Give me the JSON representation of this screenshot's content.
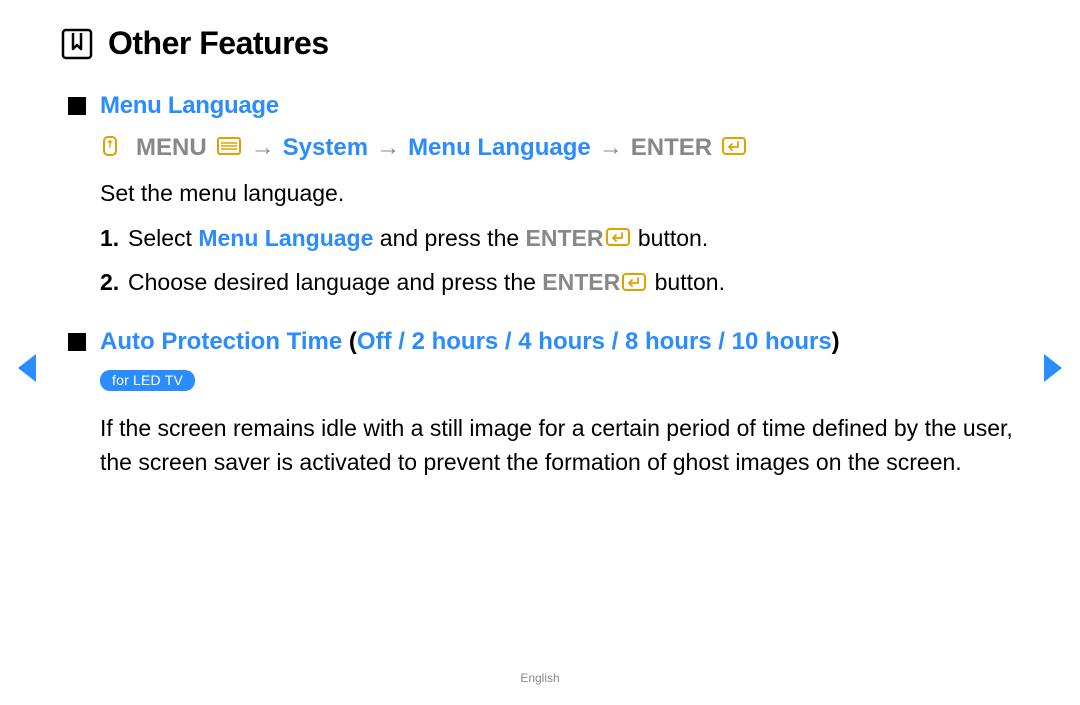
{
  "title": "Other Features",
  "sections": {
    "menuLanguage": {
      "heading": "Menu Language",
      "nav": {
        "menu": "MENU",
        "arrow": "→",
        "system": "System",
        "menuLanguage": "Menu Language",
        "enter": "ENTER"
      },
      "description": "Set the menu language.",
      "steps": [
        {
          "num": "1.",
          "pre": "Select ",
          "blue": "Menu Language",
          "mid": " and press the ",
          "enter": "ENTER",
          "post": " button."
        },
        {
          "num": "2.",
          "pre": "Choose desired language and press the ",
          "enter": "ENTER",
          "post": " button."
        }
      ]
    },
    "autoProtection": {
      "heading": "Auto Protection Time",
      "open": " (",
      "options": "Off / 2 hours / 4 hours / 8 hours / 10 hours",
      "close": ")",
      "badge": "for LED TV",
      "body": "If the screen remains idle with a still image for a certain period of time defined by the user, the screen saver is activated to prevent the formation of ghost images on the screen."
    }
  },
  "footer": "English"
}
